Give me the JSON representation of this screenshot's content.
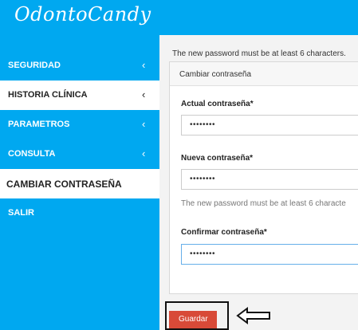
{
  "app": {
    "logo": "OdontoCandy"
  },
  "sidebar": {
    "items": [
      {
        "label": "SEGURIDAD",
        "chevron": "‹"
      },
      {
        "label": "HISTORIA CLÍNICA",
        "chevron": "‹"
      },
      {
        "label": "PARAMETROS",
        "chevron": "‹"
      },
      {
        "label": "CONSULTA",
        "chevron": "‹"
      },
      {
        "label": "CAMBIAR CONTRASEÑA"
      },
      {
        "label": "SALIR"
      }
    ]
  },
  "main": {
    "top_note": "The new password must be at least 6 characters.",
    "panel_title": "Cambiar contraseña",
    "current_label": "Actual contraseña*",
    "current_value": "••••••••",
    "new_label": "Nueva contraseña*",
    "new_value": "••••••••",
    "hint": "The new password must be at least 6 characte",
    "confirm_label": "Confirmar contraseña*",
    "confirm_value": "••••••••",
    "save_label": "Guardar"
  },
  "colors": {
    "sidebar": "#00a8f0",
    "button": "#d84a38"
  },
  "icons": {
    "arrow": "left-arrow-icon"
  }
}
